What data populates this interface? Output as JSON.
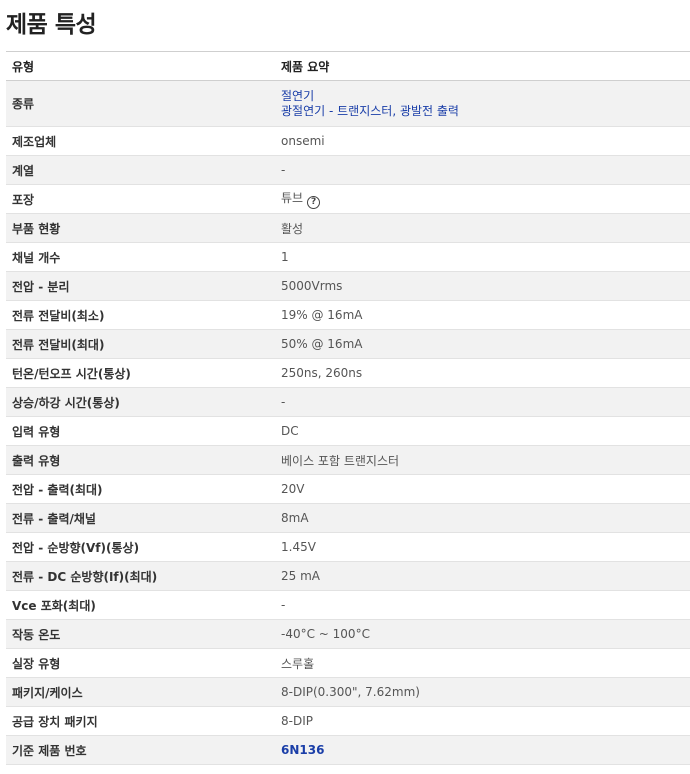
{
  "page": {
    "title": "제품 특성"
  },
  "table": {
    "headers": {
      "type": "유형",
      "summary": "제품 요약"
    },
    "rows": [
      {
        "label": "종류",
        "links": [
          "절연기",
          "광절연기 - 트랜지스터, 광발전 출력"
        ]
      },
      {
        "label": "제조업체",
        "value": "onsemi"
      },
      {
        "label": "계열",
        "value": "-"
      },
      {
        "label": "포장",
        "value": "튜브",
        "icon": "help-circle-icon",
        "icon_glyph": "?"
      },
      {
        "label": "부품 현황",
        "value": "활성"
      },
      {
        "label": "채널 개수",
        "value": "1"
      },
      {
        "label": "전압 - 분리",
        "value": "5000Vrms"
      },
      {
        "label": "전류 전달비(최소)",
        "value": "19% @ 16mA"
      },
      {
        "label": "전류 전달비(최대)",
        "value": "50% @ 16mA"
      },
      {
        "label": "턴온/턴오프 시간(통상)",
        "value": "250ns, 260ns"
      },
      {
        "label": "상승/하강 시간(통상)",
        "value": "-"
      },
      {
        "label": "입력 유형",
        "value": "DC"
      },
      {
        "label": "출력 유형",
        "value": "베이스 포함 트랜지스터"
      },
      {
        "label": "전압 - 출력(최대)",
        "value": "20V"
      },
      {
        "label": "전류 - 출력/채널",
        "value": "8mA"
      },
      {
        "label": "전압 - 순방향(Vf)(통상)",
        "value": "1.45V"
      },
      {
        "label": "전류 - DC 순방향(If)(최대)",
        "value": "25 mA"
      },
      {
        "label": "Vce 포화(최대)",
        "value": "-"
      },
      {
        "label": "작동 온도",
        "value": "-40°C ~ 100°C"
      },
      {
        "label": "실장 유형",
        "value": "스루홀"
      },
      {
        "label": "패키지/케이스",
        "value": "8-DIP(0.300\", 7.62mm)"
      },
      {
        "label": "공급 장치 패키지",
        "value": "8-DIP"
      },
      {
        "label": "기준 제품 번호",
        "link": "6N136"
      }
    ]
  },
  "colors": {
    "link": "#1a3ea8",
    "stripe": "#f2f2f2"
  }
}
